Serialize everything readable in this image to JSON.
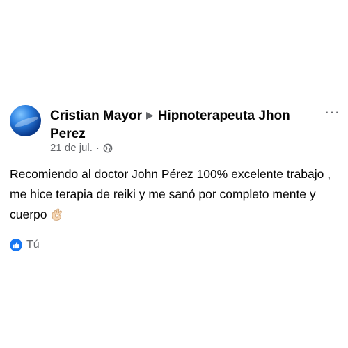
{
  "post": {
    "author": "Cristian Mayor",
    "target_page": "Hipnoterapeuta Jhon Perez",
    "date": "21 de jul.",
    "separator": "·",
    "privacy_icon": "globe-icon",
    "more_icon": "more-options-icon",
    "text": "Recomiendo al doctor John Pérez 100% excelente trabajo , me hice terapia de reiki y me sanó por completo mente y cuerpo",
    "emoji_icon": "ok-hand-icon",
    "reactions": {
      "icon": "like-icon",
      "label": "Tú"
    }
  },
  "colors": {
    "text": "#050505",
    "secondary": "#65676b",
    "like_blue": "#1877f2"
  }
}
